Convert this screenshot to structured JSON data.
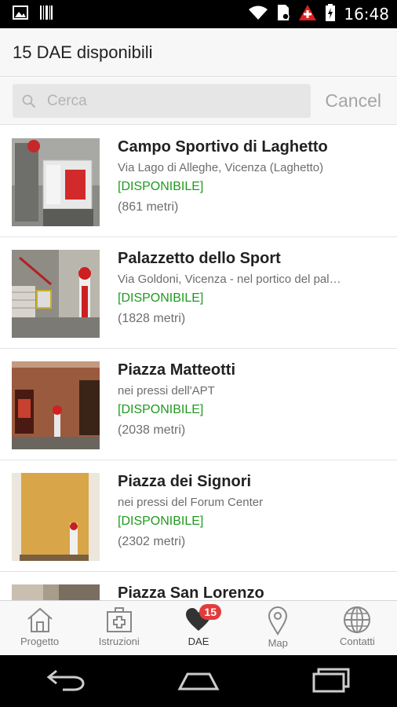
{
  "status_bar": {
    "time": "16:48",
    "icons": [
      "image-icon",
      "barcode-icon",
      "wifi-icon",
      "sim-icon",
      "first-aid-icon",
      "battery-icon"
    ]
  },
  "header": {
    "title": "15 DAE disponibili"
  },
  "search": {
    "placeholder": "Cerca",
    "value": "",
    "cancel_label": "Cancel"
  },
  "colors": {
    "status_green": "#1e9a1e",
    "badge_red": "#e23b3b"
  },
  "list": {
    "items": [
      {
        "name": "Campo Sportivo di Laghetto",
        "address": "Via Lago di Alleghe, Vicenza (Laghetto)",
        "status": "[DISPONIBILE]",
        "distance": "(861 metri)"
      },
      {
        "name": "Palazzetto dello Sport",
        "address": "Via Goldoni, Vicenza - nel portico del palazzetto",
        "status": "[DISPONIBILE]",
        "distance": "(1828 metri)"
      },
      {
        "name": "Piazza Matteotti",
        "address": "nei pressi dell'APT",
        "status": "[DISPONIBILE]",
        "distance": "(2038 metri)"
      },
      {
        "name": "Piazza dei Signori",
        "address": "nei pressi del Forum Center",
        "status": "[DISPONIBILE]",
        "distance": "(2302 metri)"
      },
      {
        "name": "Piazza San Lorenzo",
        "address": "",
        "status": "",
        "distance": ""
      }
    ]
  },
  "tabs": [
    {
      "label": "Progetto",
      "icon": "home-icon"
    },
    {
      "label": "Istruzioni",
      "icon": "first-aid-kit-icon"
    },
    {
      "label": "DAE",
      "icon": "heart-icon",
      "badge": "15"
    },
    {
      "label": "Map",
      "icon": "map-pin-icon"
    },
    {
      "label": "Contatti",
      "icon": "globe-icon"
    }
  ],
  "nav": {
    "icons": [
      "back-icon",
      "home-nav-icon",
      "recents-icon"
    ]
  }
}
